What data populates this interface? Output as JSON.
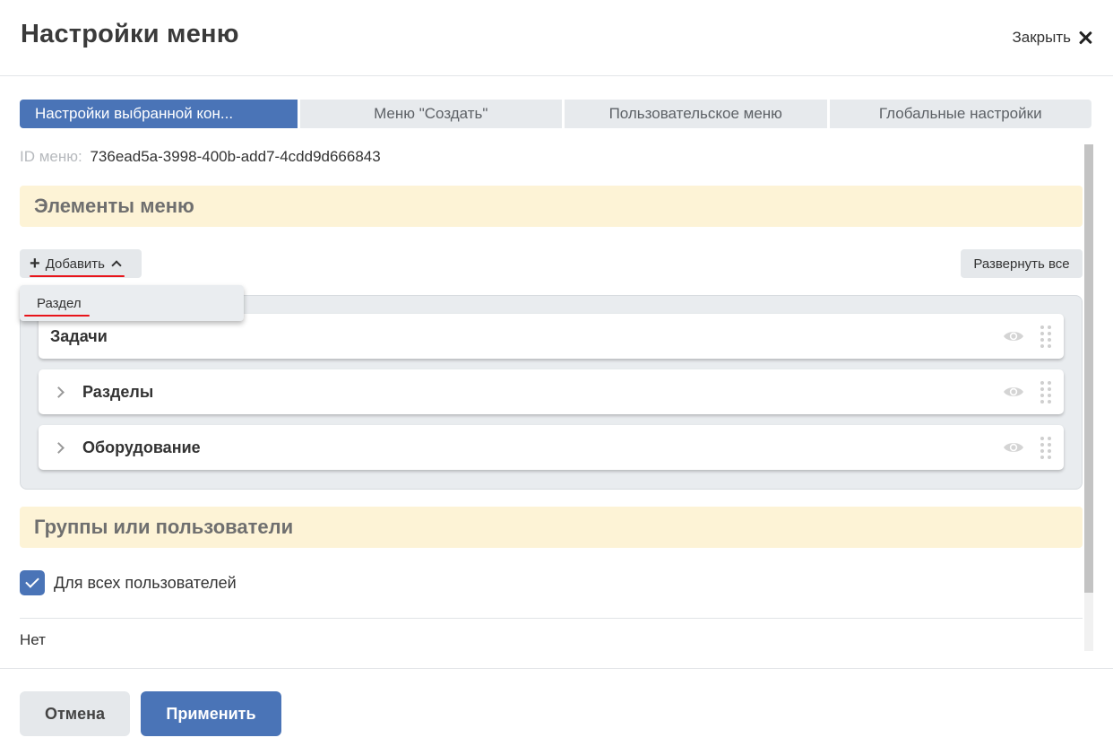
{
  "header": {
    "title": "Настройки меню",
    "close_label": "Закрыть"
  },
  "tabs": [
    {
      "label": "Настройки выбранной кон...",
      "active": true
    },
    {
      "label": "Меню \"Создать\"",
      "active": false
    },
    {
      "label": "Пользовательское меню",
      "active": false
    },
    {
      "label": "Глобальные настройки",
      "active": false
    }
  ],
  "menu_id": {
    "label": "ID меню:",
    "value": "736ead5a-3998-400b-add7-4cdd9d666843"
  },
  "menu_items_section": {
    "title": "Элементы меню",
    "add_label": "Добавить",
    "expand_all_label": "Развернуть все",
    "dropdown_option": "Раздел",
    "items": [
      {
        "name": "Задачи",
        "expandable": false
      },
      {
        "name": "Разделы",
        "expandable": true
      },
      {
        "name": "Оборудование",
        "expandable": true
      }
    ]
  },
  "groups_section": {
    "title": "Группы или пользователи",
    "all_users_label": "Для всех пользователей",
    "all_users_checked": true,
    "none_text": "Нет"
  },
  "footer": {
    "cancel_label": "Отмена",
    "apply_label": "Применить"
  },
  "colors": {
    "accent": "#4a74b7",
    "section_bg": "#fdf3d6",
    "annotation_red": "#e8141a"
  }
}
